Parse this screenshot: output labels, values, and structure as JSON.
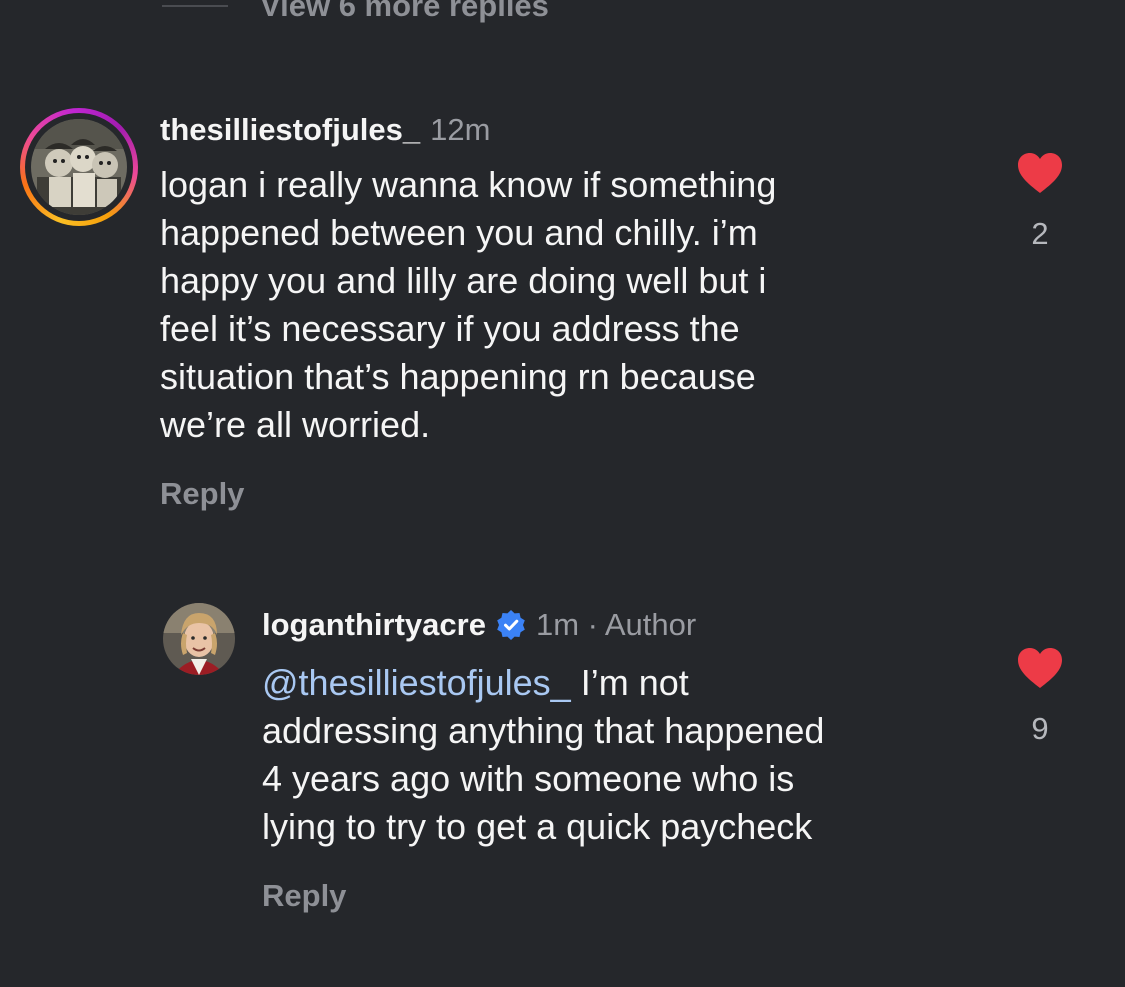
{
  "thread": {
    "view_more_label": "View 6 more replies"
  },
  "comments": [
    {
      "username": "thesilliestofjules_",
      "time": "12m",
      "text": "logan i really wanna know if something\nhappened between you and chilly. i’m\nhappy you and lilly are doing well but i\nfeel it’s necessary if you address the\nsituation that’s happening rn because\nwe’re all worried.",
      "reply_label": "Reply",
      "like_count": "2",
      "liked": true,
      "has_story_ring": true
    },
    {
      "username": "loganthirtyacre",
      "verified": true,
      "time": "1m · Author",
      "mention": "@thesilliestofjules_",
      "text": " I’m not\naddressing anything that happened\n4 years ago with someone who is\nlying to try to get a quick paycheck",
      "reply_label": "Reply",
      "like_count": "9",
      "liked": true
    }
  ],
  "icons": {
    "heart": "heart-filled-icon",
    "verified": "verified-badge-icon"
  },
  "colors": {
    "background": "#25272b",
    "heart": "#ed3b47",
    "mention": "#a9c8f2",
    "verified": "#3b82f6"
  }
}
